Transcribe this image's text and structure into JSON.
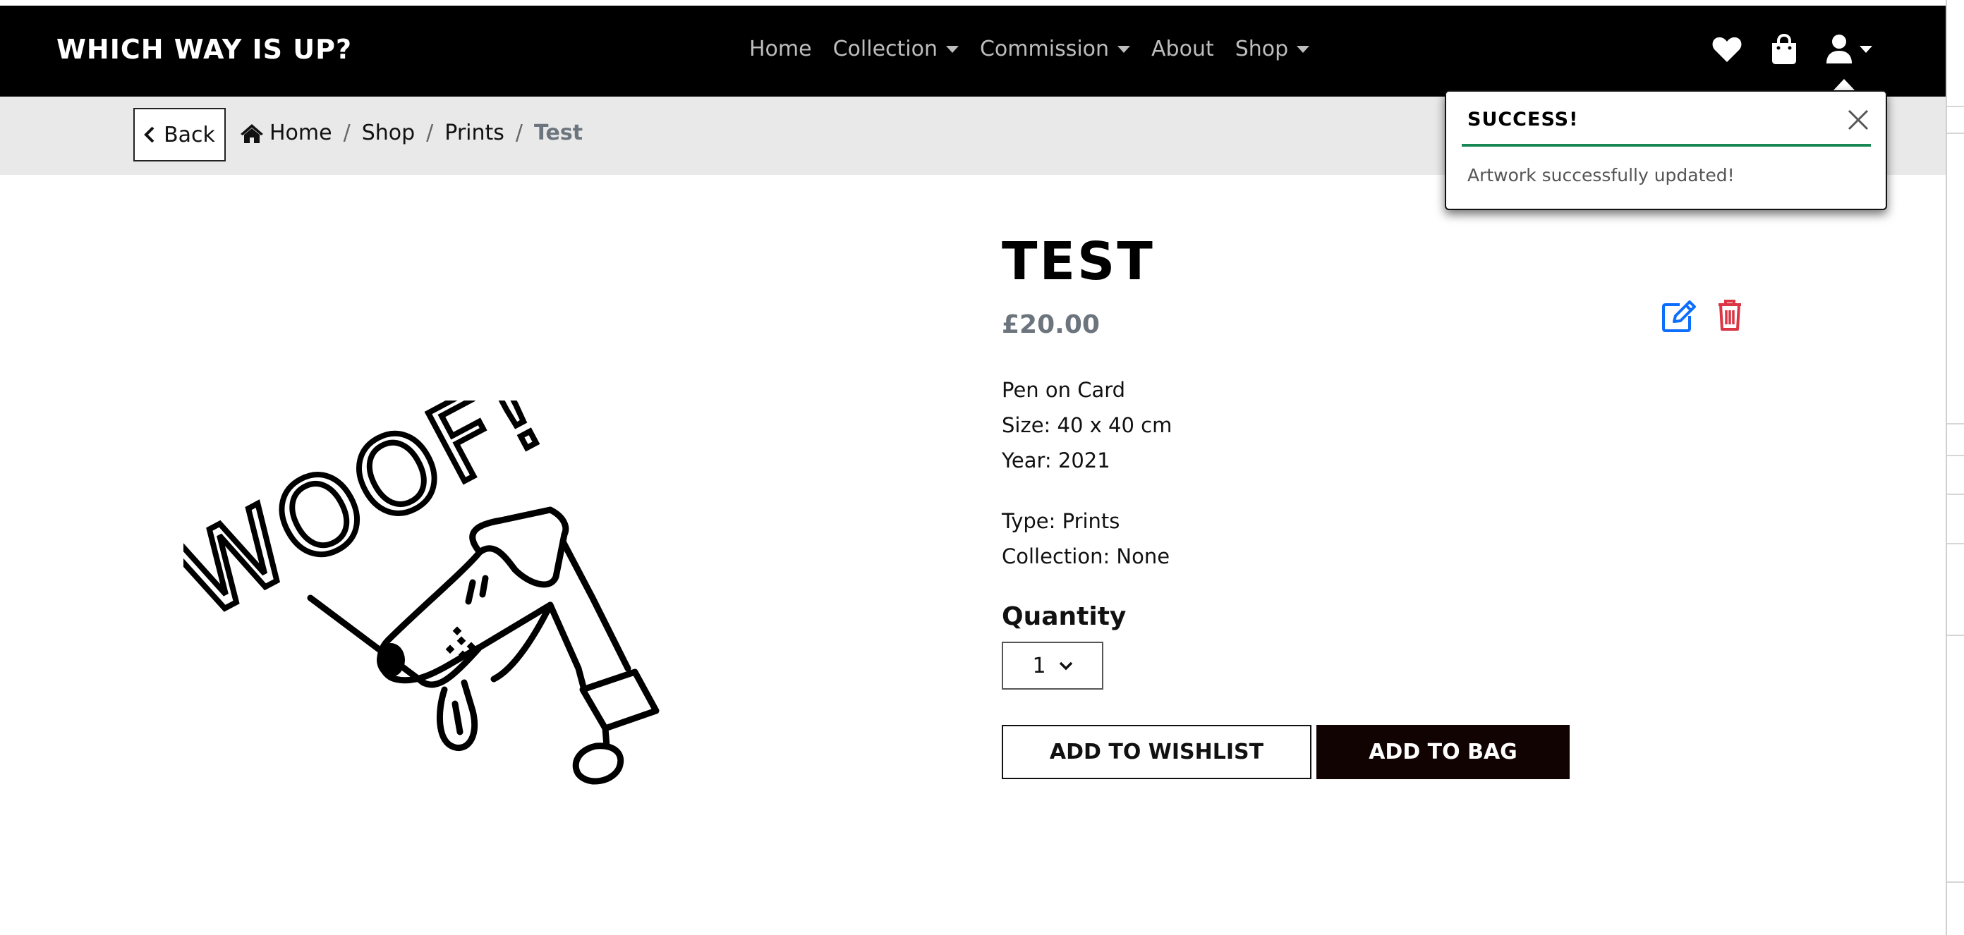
{
  "navbar": {
    "brand": "WHICH WAY IS UP?",
    "links": [
      {
        "label": "Home",
        "dropdown": false
      },
      {
        "label": "Collection",
        "dropdown": true
      },
      {
        "label": "Commission",
        "dropdown": true
      },
      {
        "label": "About",
        "dropdown": false
      },
      {
        "label": "Shop",
        "dropdown": true
      }
    ],
    "icons": [
      "heart-icon",
      "shopping-bag-icon",
      "user-icon"
    ]
  },
  "breadcrumb": {
    "back_label": "Back",
    "items": [
      "Home",
      "Shop",
      "Prints"
    ],
    "separator": "/",
    "active": "Test"
  },
  "product": {
    "title": "TEST",
    "price": "£20.00",
    "medium": "Pen on Card",
    "size": "Size: 40 x 40 cm",
    "year": "Year: 2021",
    "type": "Type: Prints",
    "collection": "Collection: None",
    "quantity_label": "Quantity",
    "quantity_value": "1",
    "wishlist_button": "ADD TO WISHLIST",
    "bag_button": "ADD TO BAG",
    "image_text": "WOOF!"
  },
  "toast": {
    "title": "SUCCESS!",
    "message": "Artwork successfully updated!"
  },
  "colors": {
    "navbar_bg": "#000000",
    "breadcrumb_bg": "#e9e9e9",
    "edit_icon": "#0d6efd",
    "delete_icon": "#dc3545",
    "success_rule": "#198754",
    "bag_button_bg": "#120303"
  }
}
